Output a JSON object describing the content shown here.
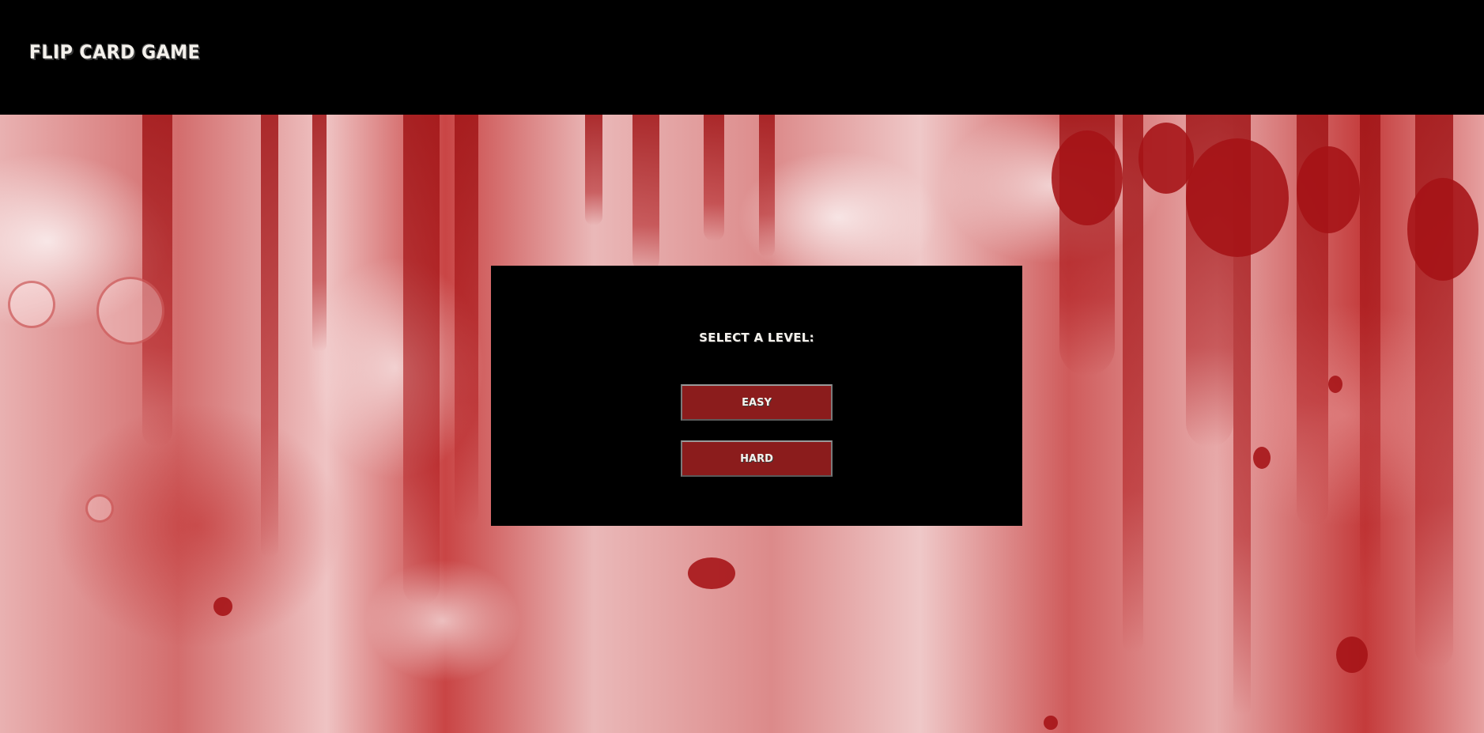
{
  "app": {
    "title": "FLIP CARD GAME"
  },
  "level_select": {
    "heading": "SELECT A LEVEL:",
    "buttons": [
      {
        "label": "EASY"
      },
      {
        "label": "HARD"
      }
    ]
  },
  "colors": {
    "header_background": "#000000",
    "panel_background": "#000000",
    "button_background": "#8b1c1c",
    "text": "#f4f1ec",
    "blood_red": "#a51216"
  }
}
